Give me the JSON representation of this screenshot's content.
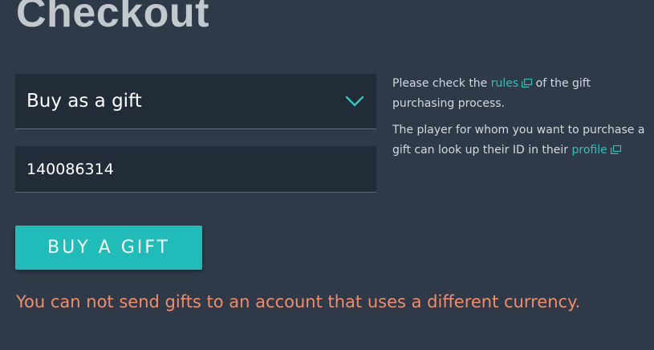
{
  "page": {
    "title": "Checkout"
  },
  "form": {
    "purchase_type": {
      "selected": "Buy as a gift"
    },
    "player_id": {
      "value": "140086314"
    },
    "submit_label": "BUY A GIFT",
    "error": "You can not send gifts to an account that uses a different currency."
  },
  "info": {
    "p1_before": "Please check the",
    "rules_link": "rules",
    "p1_after": "of the gift purchasing process.",
    "p2_before": "The player for whom you want to purchase a gift can look up their ID in their",
    "profile_link": "profile"
  },
  "colors": {
    "background": "#2e3a47",
    "field": "#222c38",
    "accent": "#1fbcb9",
    "link": "#31bfbc",
    "error": "#f28c6b"
  },
  "icons": {
    "dropdown": "chevron-down-icon",
    "external": "external-link-icon"
  }
}
